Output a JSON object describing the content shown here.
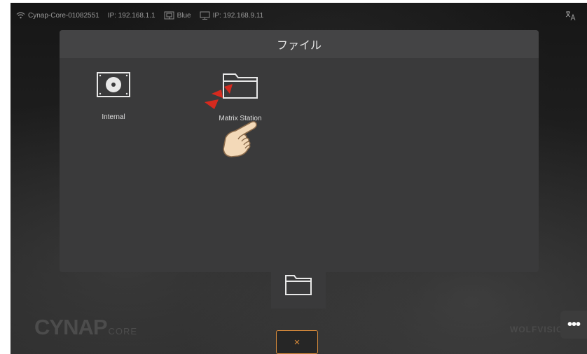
{
  "status_bar": {
    "network_name": "Cynap-Core-01082551",
    "ip_primary": "IP: 192.168.1.1",
    "lan_label": "Blue",
    "ip_secondary": "IP: 192.168.9.11"
  },
  "modal": {
    "title": "ファイル",
    "items": [
      {
        "label": "Internal",
        "icon": "hard-drive-icon"
      },
      {
        "label": "Matrix Station",
        "icon": "folder-icon"
      }
    ]
  },
  "bottom": {
    "source_tab_icon": "folder-icon",
    "close_label": "×",
    "more_label": "•••",
    "brand_left": "CYNAP",
    "brand_left_sub": "CORE",
    "brand_right": "WOLFVISION"
  },
  "annotation": {
    "hand_icon": "pointing-hand-icon",
    "tap_marks_color": "#d62a1e"
  },
  "colors": {
    "accent": "#d98b3a",
    "modal_bg": "#3a3a3b"
  }
}
